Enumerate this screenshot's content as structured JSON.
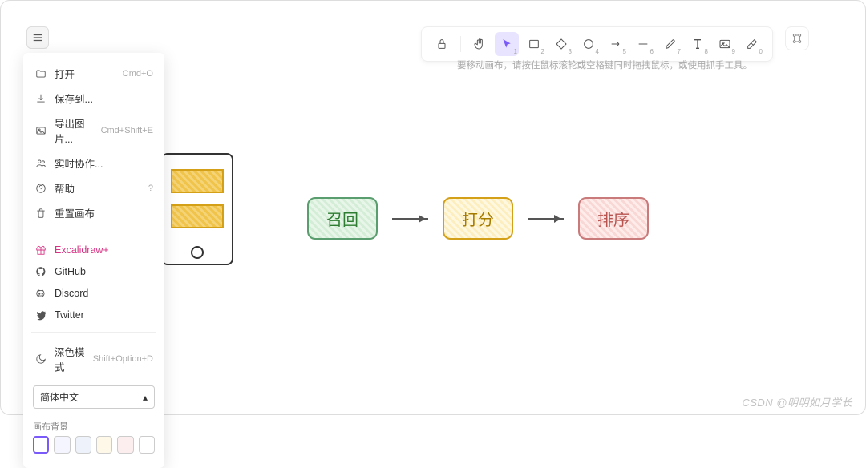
{
  "menu": {
    "open": {
      "label": "打开",
      "shortcut": "Cmd+O"
    },
    "save": {
      "label": "保存到..."
    },
    "export": {
      "label": "导出图片...",
      "shortcut": "Cmd+Shift+E"
    },
    "collab": {
      "label": "实时协作..."
    },
    "help": {
      "label": "帮助",
      "shortcut": "?"
    },
    "reset": {
      "label": "重置画布"
    },
    "plus": {
      "label": "Excalidraw+"
    },
    "github": {
      "label": "GitHub"
    },
    "discord": {
      "label": "Discord"
    },
    "twitter": {
      "label": "Twitter"
    },
    "darkmode": {
      "label": "深色模式",
      "shortcut": "Shift+Option+D"
    },
    "language": {
      "label": "简体中文"
    },
    "bg_section": "画布背景"
  },
  "swatches": [
    "#ffffff",
    "#f5f5ff",
    "#eef3fb",
    "#fdf8e8",
    "#fceeee",
    "#ffffff"
  ],
  "toolbar": {
    "tools": [
      {
        "name": "lock",
        "num": ""
      },
      {
        "name": "hand",
        "num": ""
      },
      {
        "name": "selection",
        "num": "1",
        "active": true
      },
      {
        "name": "rectangle",
        "num": "2"
      },
      {
        "name": "diamond",
        "num": "3"
      },
      {
        "name": "ellipse",
        "num": "4"
      },
      {
        "name": "arrow",
        "num": "5"
      },
      {
        "name": "line",
        "num": "6"
      },
      {
        "name": "draw",
        "num": "7"
      },
      {
        "name": "text",
        "num": "8"
      },
      {
        "name": "image",
        "num": "9"
      },
      {
        "name": "eraser",
        "num": "0"
      }
    ]
  },
  "hint": "要移动画布，请按住鼠标滚轮或空格键同时拖拽鼠标，或使用抓手工具。",
  "flow": {
    "n1": "召回",
    "n2": "打分",
    "n3": "排序"
  },
  "watermark": "CSDN @明明如月学长"
}
